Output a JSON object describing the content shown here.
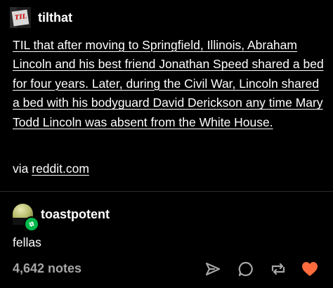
{
  "post": {
    "author": "tilthat",
    "avatar_icon": "til-logo-icon",
    "body_text": "TIL that after moving to Springfield, Illinois, Abraham Lincoln and his best friend Jonathan Speed shared a bed for four years. Later, during the Civil War, Lincoln shared a bed with his bodyguard David Derickson any time Mary Todd Lincoln was absent from the White House.",
    "via_prefix": "via",
    "via_link": "reddit.com"
  },
  "reblog": {
    "author": "toastpotent",
    "avatar_icon": "helmet-avatar-icon",
    "badge_icon": "reblog-icon",
    "text": "fellas"
  },
  "footer": {
    "notes": "4,642 notes",
    "actions": [
      {
        "name": "share",
        "icon": "share-arrow-icon"
      },
      {
        "name": "reply",
        "icon": "reply-bubble-icon"
      },
      {
        "name": "reblog",
        "icon": "reblog-icon"
      },
      {
        "name": "like",
        "icon": "heart-icon"
      }
    ]
  },
  "colors": {
    "background": "#000000",
    "text": "#ffffff",
    "muted": "#a6a6a6",
    "reblog_badge": "#00b84a",
    "heart": "#ff6b3d"
  }
}
